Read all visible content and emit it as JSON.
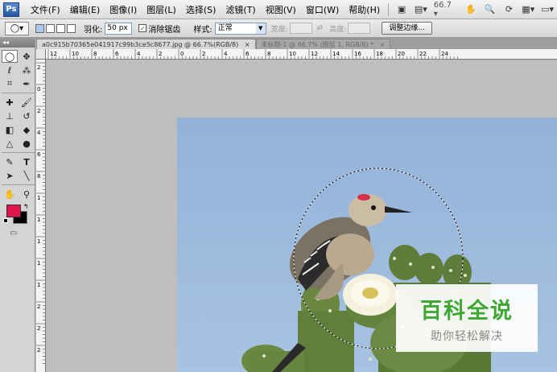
{
  "app": {
    "logo": "Ps"
  },
  "menu": [
    {
      "label": "文件(F)"
    },
    {
      "label": "编辑(E)"
    },
    {
      "label": "图像(I)"
    },
    {
      "label": "图层(L)"
    },
    {
      "label": "选择(S)"
    },
    {
      "label": "滤镜(T)"
    },
    {
      "label": "视图(V)"
    },
    {
      "label": "窗口(W)"
    },
    {
      "label": "帮助(H)"
    }
  ],
  "menubar_right": {
    "zoom": "66.7"
  },
  "options": {
    "feather_label": "羽化:",
    "feather_value": "50 px",
    "antialias_label": "消除锯齿",
    "style_label": "样式:",
    "style_value": "正常",
    "width_label": "宽度:",
    "height_label": "高度:",
    "refine_label": "调整边缘..."
  },
  "tabs": [
    {
      "label": "a0c915b70365e041917c99b3ce5c8677.jpg @ 66.7%(RGB/8)",
      "close": "×",
      "active": true
    },
    {
      "label": "未标题-1 @ 66.7% (图层 1, RGB/8) *",
      "close": "×",
      "active": false
    }
  ],
  "ruler": {
    "h_labels": [
      "12",
      "10",
      "8",
      "6",
      "4",
      "2",
      "0",
      "2",
      "4",
      "6",
      "8",
      "10",
      "12",
      "14",
      "16",
      "18",
      "20",
      "22",
      "24"
    ],
    "v_labels": [
      "2",
      "0",
      "2",
      "4",
      "6",
      "8",
      "1",
      "1",
      "1",
      "1",
      "1",
      "2",
      "2",
      "2"
    ]
  },
  "colors": {
    "foreground": "#e0134a",
    "background": "#000000"
  },
  "watermark": {
    "title": "百科全说",
    "subtitle": "助你轻松解决"
  }
}
